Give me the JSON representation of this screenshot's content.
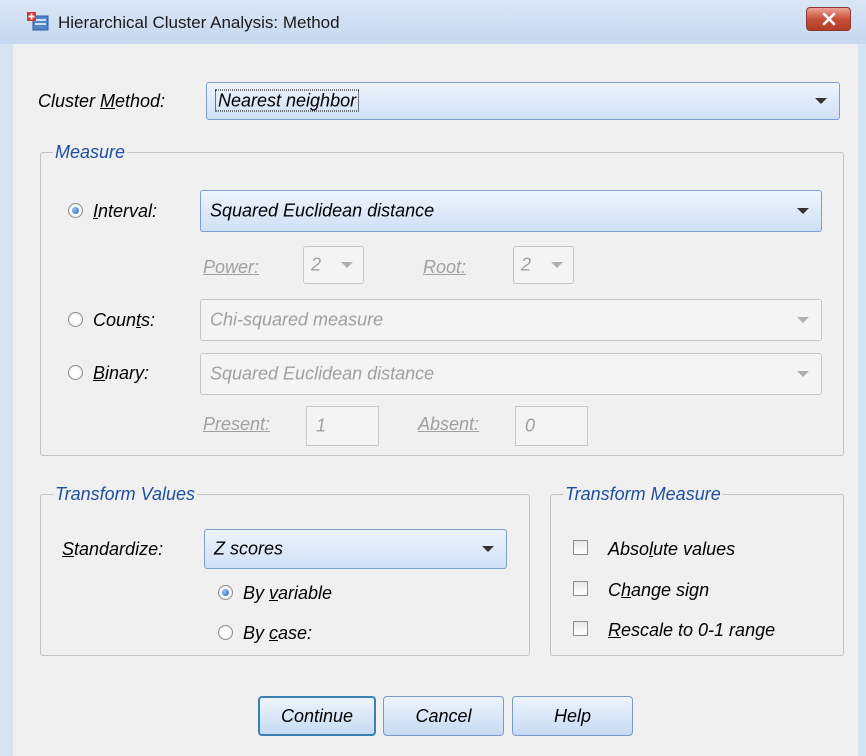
{
  "window": {
    "title": "Hierarchical Cluster Analysis: Method",
    "close_icon": "close-x-icon",
    "app_icon": "spss-dialog-icon",
    "accent": "#c8503b"
  },
  "cluster_method": {
    "label_pre": "Cluster ",
    "label_u": "M",
    "label_post": "ethod:",
    "value": "Nearest neighbor"
  },
  "measure": {
    "legend": "Measure",
    "interval": {
      "label_u": "I",
      "label_post": "nterval:",
      "selected": true,
      "value": "Squared Euclidean distance"
    },
    "power": {
      "label": "Power:",
      "value": "2"
    },
    "root": {
      "label": "Root:",
      "value": "2"
    },
    "counts": {
      "label_pre": "Coun",
      "label_u": "t",
      "label_post": "s:",
      "selected": false,
      "value": "Chi-squared measure"
    },
    "binary": {
      "label_u": "B",
      "label_post": "inary:",
      "selected": false,
      "value": "Squared Euclidean distance"
    },
    "present": {
      "label": "Present:",
      "value": "1"
    },
    "absent": {
      "label": "Absent:",
      "value": "0"
    }
  },
  "transform_values": {
    "legend": "Transform Values",
    "standardize_u": "S",
    "standardize_post": "tandardize:",
    "standardize_value": "Z scores",
    "by_variable_pre": "By ",
    "by_variable_u": "v",
    "by_variable_post": "ariable",
    "by_variable_selected": true,
    "by_case_pre": "By ",
    "by_case_u": "c",
    "by_case_post": "ase:",
    "by_case_selected": false
  },
  "transform_measure": {
    "legend": "Transform Measure",
    "absolute_pre": "Abso",
    "absolute_u": "l",
    "absolute_post": "ute values",
    "absolute_checked": false,
    "change_pre": "C",
    "change_u": "h",
    "change_post": "ange sign",
    "change_checked": false,
    "rescale_u": "R",
    "rescale_post": "escale to 0-1 range",
    "rescale_checked": false
  },
  "buttons": {
    "continue": "Continue",
    "cancel": "Cancel",
    "help": "Help"
  }
}
